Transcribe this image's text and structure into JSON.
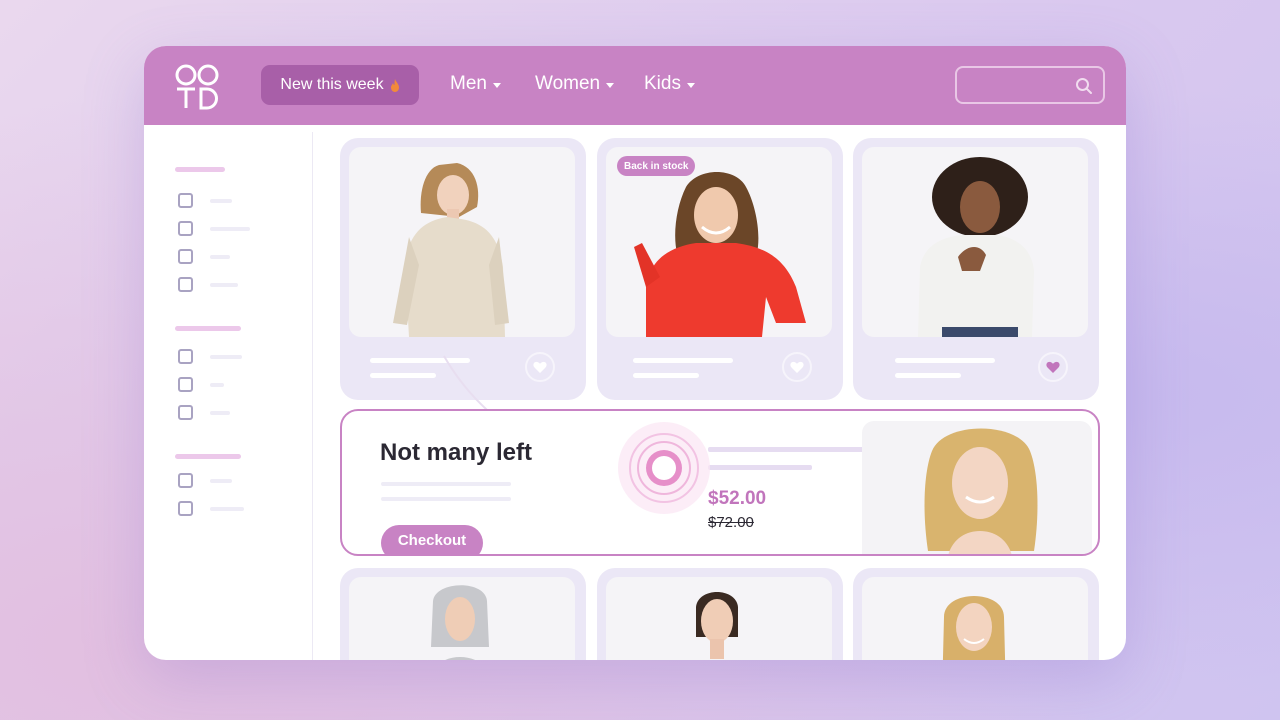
{
  "header": {
    "new_this_week": "New this week",
    "nav": [
      {
        "label": "Men"
      },
      {
        "label": "Women"
      },
      {
        "label": "Kids"
      }
    ],
    "search_placeholder": ""
  },
  "products": [
    {
      "badge": "",
      "favorited": false,
      "sweater_color": "#e6dccb",
      "hair_color": "#b58a58"
    },
    {
      "badge": "Back in stock",
      "favorited": false,
      "sweater_color": "#ee3a2e",
      "hair_color": "#6b4628"
    },
    {
      "badge": "",
      "favorited": true,
      "sweater_color": "#f2f2f0",
      "hair_color": "#2e2019"
    }
  ],
  "promo": {
    "title": "Not many left",
    "checkout_label": "Checkout",
    "price": "$52.00",
    "old_price": "$72.00"
  },
  "colors": {
    "brand": "#c883c4",
    "brand_dark": "#a85fa8",
    "card_bg": "#ebe7f6"
  }
}
